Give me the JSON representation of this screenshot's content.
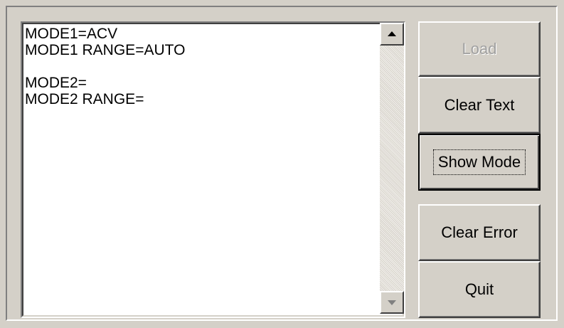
{
  "output_text": {
    "content": "MODE1=ACV\nMODE1 RANGE=AUTO\n\nMODE2=\nMODE2 RANGE="
  },
  "buttons": {
    "load": "Load",
    "clear_text": "Clear Text",
    "show_mode": "Show Mode",
    "clear_error": "Clear Error",
    "quit": "Quit"
  },
  "icons": {
    "scroll_up": "triangle-up-icon",
    "scroll_down": "triangle-down-icon"
  },
  "colors": {
    "face": "#d4d0c8",
    "disabled_text": "#a0a0a0"
  }
}
